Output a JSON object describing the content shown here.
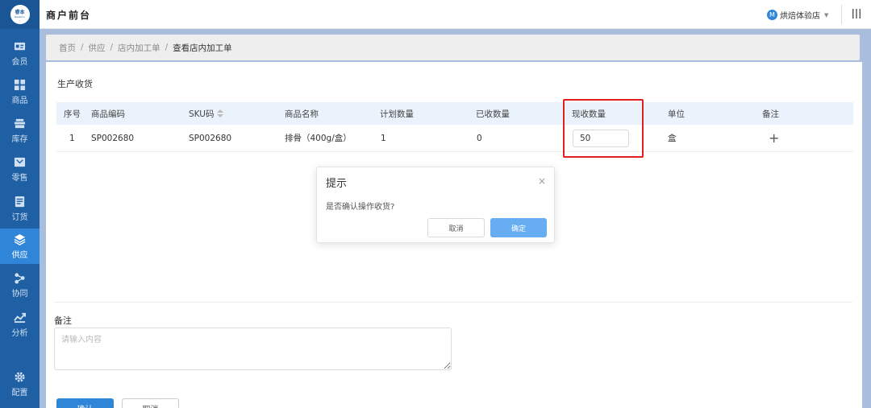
{
  "app": {
    "title": "商户前台",
    "logo_text": "睿本",
    "logo_sub": "Realsion"
  },
  "header": {
    "store_avatar_letter": "M",
    "store_name": "烘焙体验店",
    "store_caret_icon": "caret-down-icon",
    "menu_icon": "vertical-bars-icon"
  },
  "sidebar": {
    "items": [
      {
        "label": "会员",
        "icon": "member-card-icon",
        "active": false
      },
      {
        "label": "商品",
        "icon": "grid-icon",
        "active": false
      },
      {
        "label": "库存",
        "icon": "inventory-icon",
        "active": false
      },
      {
        "label": "零售",
        "icon": "retail-icon",
        "active": false
      },
      {
        "label": "订货",
        "icon": "order-icon",
        "active": false
      },
      {
        "label": "供应",
        "icon": "layers-icon",
        "active": true
      },
      {
        "label": "协同",
        "icon": "share-icon",
        "active": false
      },
      {
        "label": "分析",
        "icon": "trend-chart-icon",
        "active": false
      },
      {
        "label": "配置",
        "icon": "gear-icon",
        "active": false
      }
    ]
  },
  "breadcrumb": {
    "items": [
      "首页",
      "供应",
      "店内加工单",
      "查看店内加工单"
    ],
    "separator": "/"
  },
  "section": {
    "title": "生产收货"
  },
  "table": {
    "headers": {
      "index": "序号",
      "code": "商品编码",
      "sku": "SKU码",
      "name": "商品名称",
      "planned": "计划数量",
      "received": "已收数量",
      "current": "现收数量",
      "unit": "单位",
      "remark": "备注"
    },
    "rows": [
      {
        "index": "1",
        "code": "SP002680",
        "sku": "SP002680",
        "name": "排骨（400g/盒）",
        "planned": "1",
        "received": "0",
        "current": "50",
        "unit": "盒",
        "remark_add": "+"
      }
    ]
  },
  "remarks": {
    "label": "备注",
    "placeholder": "请输入内容"
  },
  "footer": {
    "confirm_label": "确认",
    "cancel_label": "取消"
  },
  "dialog": {
    "title": "提示",
    "close": "×",
    "message": "是否确认操作收货?",
    "cancel_label": "取消",
    "ok_label": "确定"
  },
  "colors": {
    "sidebar": "#1f5fa3",
    "sidebar_active": "#2f86d8",
    "primary": "#2f86d8",
    "dialog_ok": "#66adf2",
    "highlight": "#e02020",
    "table_header": "#eaf3fb"
  }
}
